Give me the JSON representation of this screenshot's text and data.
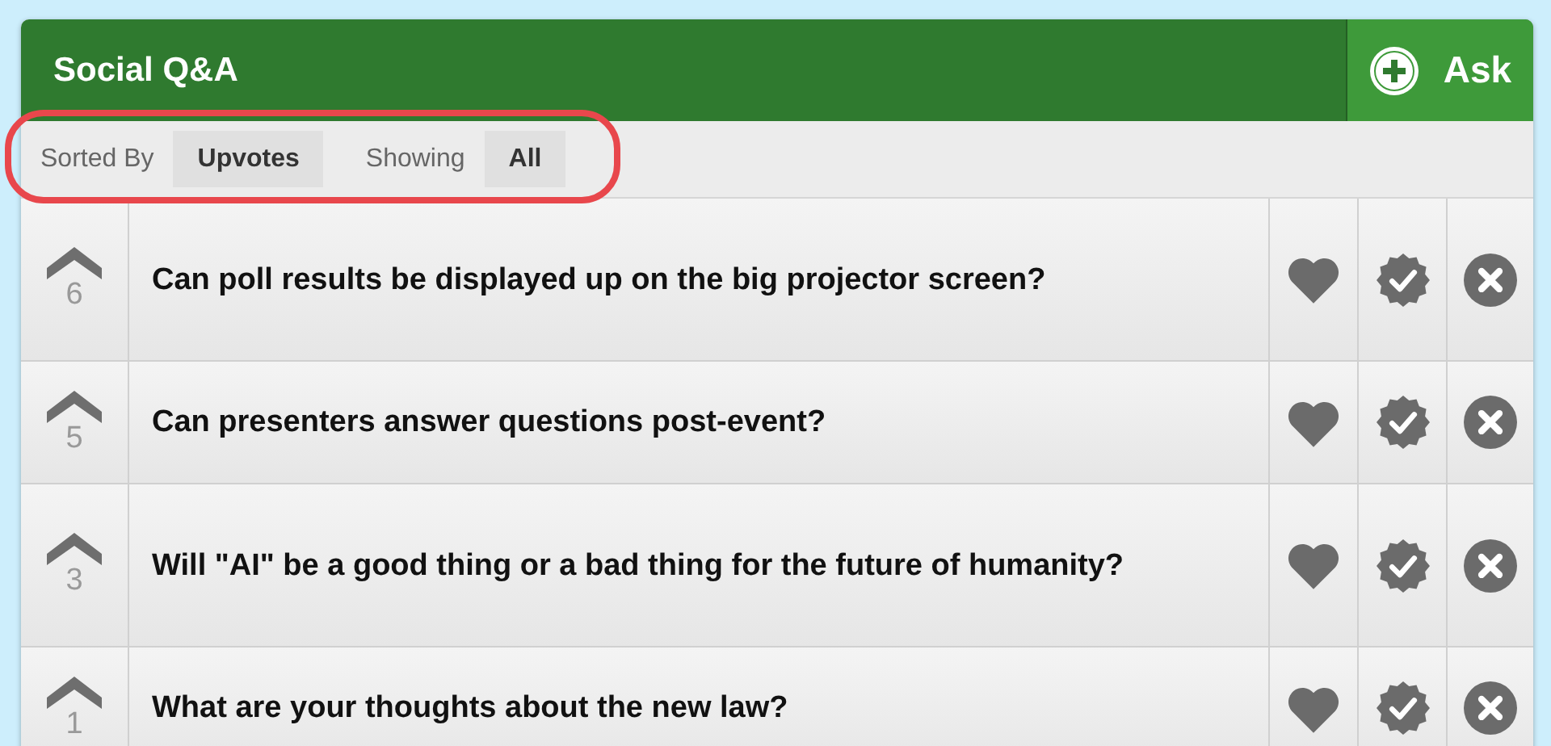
{
  "header": {
    "title": "Social Q&A",
    "ask_button": "Ask"
  },
  "filters": [
    {
      "label": "Sorted By",
      "value": "Upvotes"
    },
    {
      "label": "Showing",
      "value": "All"
    }
  ],
  "questions": [
    {
      "votes": "6",
      "text": "Can poll results be displayed up on the big projector screen?"
    },
    {
      "votes": "5",
      "text": "Can presenters answer questions post-event?"
    },
    {
      "votes": "3",
      "text": "Will \"AI\" be a good thing or a bad thing for the future of humanity?"
    },
    {
      "votes": "1",
      "text": "What are your thoughts about the new law?"
    }
  ]
}
